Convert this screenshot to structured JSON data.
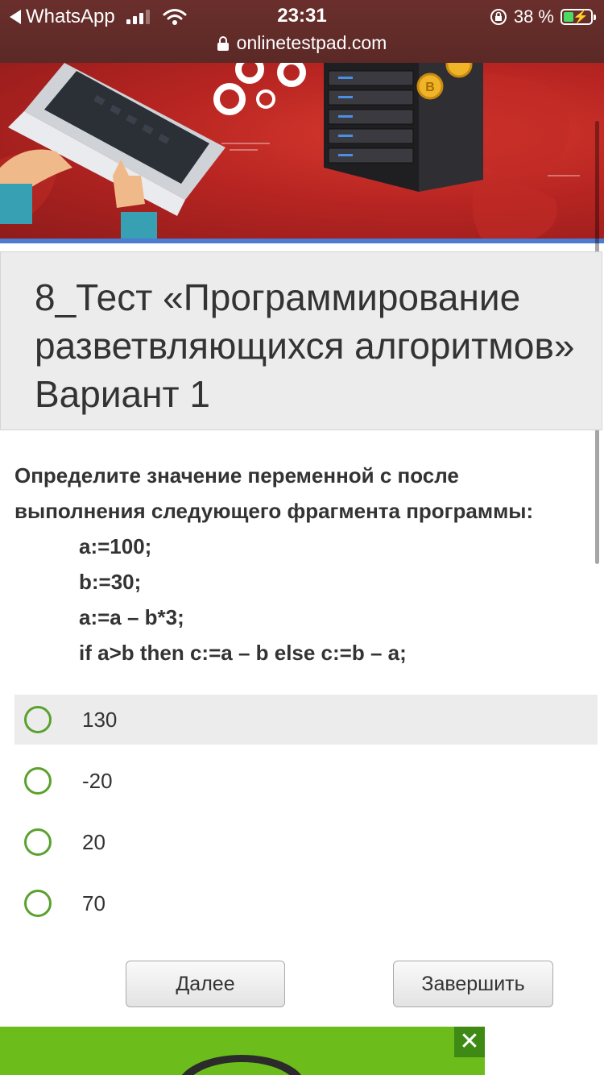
{
  "status_bar": {
    "back_app": "WhatsApp",
    "time": "23:31",
    "battery": "38 %",
    "url": "onlinetestpad.com"
  },
  "test": {
    "title": "8_Тест «Программирование разветвляющихся алгоритмов» Вариант 1"
  },
  "question": {
    "text_line1": "Определите значение переменной с после",
    "text_line2": "выполнения следующего фрагмента программы:",
    "code": [
      "a:=100;",
      "b:=30;",
      "a:=a – b*3;",
      "if a>b then c:=a – b else c:=b – a;"
    ]
  },
  "options": [
    "130",
    "-20",
    "20",
    "70"
  ],
  "buttons": {
    "next": "Далее",
    "finish": "Завершить"
  },
  "ad": {
    "close": "✕"
  },
  "colors": {
    "status_bg": "#5b2926",
    "banner_red": "#b82522",
    "banner_stripe": "#4c7bd0",
    "radio_green": "#5aa12e",
    "ad_green": "#6cbd1c"
  }
}
